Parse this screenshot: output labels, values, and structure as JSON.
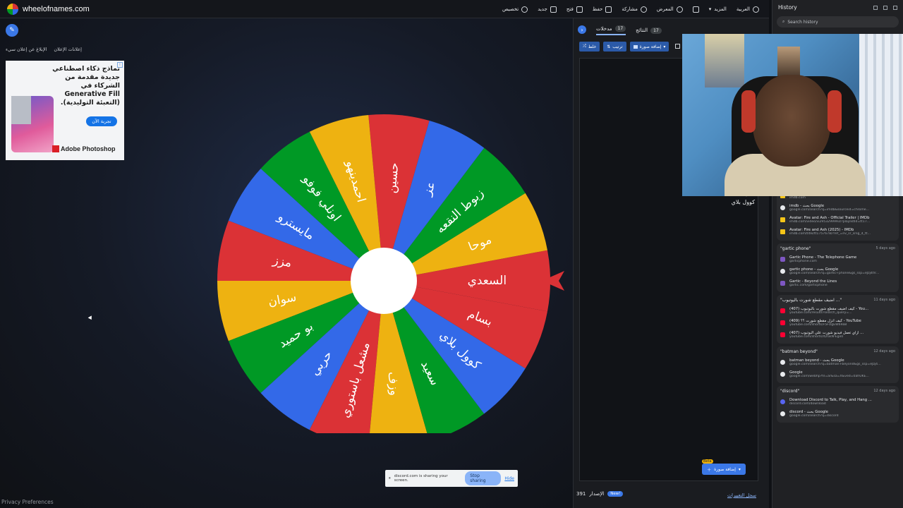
{
  "app": {
    "site_name": "wheelofnames.com",
    "privacy": "Privacy Preferences"
  },
  "nav": [
    {
      "label": "العربية",
      "icon": "globe-icon"
    },
    {
      "label": "المزيد",
      "icon": "chevron-down-icon"
    },
    {
      "label": "",
      "icon": "fullscreen-icon"
    },
    {
      "label": "المعرض",
      "icon": "search-icon"
    },
    {
      "label": "مشاركة",
      "icon": "share-icon"
    },
    {
      "label": "حفظ",
      "icon": "save-icon"
    },
    {
      "label": "فتح",
      "icon": "folder-icon"
    },
    {
      "label": "جديد",
      "icon": "file-icon"
    },
    {
      "label": "تخصيص",
      "icon": "palette-icon"
    }
  ],
  "report": {
    "report_ad": "الإبلاغ عن إعلان سيء",
    "about_ads": "إعلانات الإعلان"
  },
  "ad": {
    "headline": "نماذج ذكاء اصطناعي جديدة مقدمة من الشركاء في Generative Fill (التعبئة التوليدية).",
    "cta": "تجربة الآن",
    "brand": "Adobe Photoshop"
  },
  "wheel": {
    "colors": [
      "#db3236",
      "#3369e8",
      "#009925",
      "#eeb211"
    ],
    "pointer_color": "#db3236",
    "segments": [
      "السعدي",
      "موحا",
      "زبوط النقعه",
      "عز",
      "حسين",
      "احمدينهو",
      "اونلي فوفو",
      "مايسترو",
      "مزز",
      "سوان",
      "بو حميد",
      "حربي",
      "مشعل باستوري",
      "وزف",
      "سعيد",
      "كوول بلاي",
      "بسام"
    ]
  },
  "panel": {
    "tab_entries": "مدخلات",
    "tab_entries_count": "17",
    "tab_results": "النتائج",
    "tab_results_count": "17",
    "shuffle": "خلط",
    "sort": "ترتيب",
    "add_image": "إضافة صورة",
    "entries": [
      "بسام",
      "السعدي",
      "موحا",
      "زبوط النقعه",
      "عز",
      "حسين",
      "احمدينهو",
      "اونلي فوفو",
      "مايسترو",
      "مزز",
      "سوان",
      "بو حميد",
      "حربي",
      "مشعل باستوري",
      "وزف",
      "سعيد",
      "كوول بلاي"
    ],
    "beta": "Beta",
    "add_image_bottom": "إضافة صورة",
    "version_label": "الإصدار",
    "version": "391",
    "new_badge": "New!",
    "changelog": "سجل التغييرات"
  },
  "share_bar": {
    "text": "discord.com is sharing your screen.",
    "stop": "Stop sharing",
    "hide": "Hide"
  },
  "history": {
    "title": "History",
    "search_placeholder": "Search history",
    "groups": [
      {
        "title": "",
        "date": "",
        "items": [
          {
            "t": "IMDb: Ratings, Reviews, and Where to Wat...",
            "u": "imdb.com",
            "fav": "imdb"
          },
          {
            "t": "imdb - بحث Google",
            "u": "google.com/search?q=imdb&sourceid=chrome...",
            "fav": "google"
          },
          {
            "t": "Avatar: Fire and Ash - Official Trailer | IMDb",
            "u": "imdb.com/video/vi2953299993/?playlistId=tt17...",
            "fav": "imdb"
          },
          {
            "t": "Avatar: Fire and Ash (2025) - IMDb",
            "u": "imdb.com/title/tt1757678/?ref_=nv_sr_srsg_4_tt...",
            "fav": "imdb"
          }
        ]
      },
      {
        "title": "\"gartic phone\"",
        "date": "5 days ago",
        "items": [
          {
            "t": "Gartic Phone - The Telephone Game",
            "u": "garticphone.com",
            "fav": "gartic"
          },
          {
            "t": "gartic phone - بحث Google",
            "u": "google.com/search?q=gartic+phone&gs_ssp=eJzj4tVP1...",
            "fav": "google"
          },
          {
            "t": "Gartic - Beyond the Lines",
            "u": "gartic.com/garticphone",
            "fav": "gartic"
          }
        ]
      },
      {
        "title": "\"اضيف مقطع شورت باليوتيوب ...\"",
        "date": "11 days ago",
        "items": [
          {
            "t": "(407) كيف اضيف مقطع شورت باليوتيوب - You...",
            "u": "youtube.com/results?search_query=...",
            "fav": "yt"
          },
          {
            "t": "(409) كيف انزل مقطع شورت ؟؟ - YouTube",
            "u": "youtube.com/shorts/F5FOgEW69a8",
            "fav": "yt"
          },
          {
            "t": "(407) ازاي تعمل فيديو شورت علي اليوتيوب ...",
            "u": "youtube.com/shorts/lt2GkN-Egx0",
            "fav": "yt"
          }
        ]
      },
      {
        "title": "\"batman beyond\"",
        "date": "12 days ago",
        "items": [
          {
            "t": "batman beyond - بحث Google",
            "u": "google.com/search?q=batman+beyond&gs_ssp=eJzj4tTP1...",
            "fav": "google"
          },
          {
            "t": "Google",
            "u": "google.com/webhp?hl=ar&sa=X&ved=0ahUKE...",
            "fav": "google"
          }
        ]
      },
      {
        "title": "\"discord\"",
        "date": "12 days ago",
        "items": [
          {
            "t": "Download Discord to Talk, Play, and Hang ...",
            "u": "discord.com/download",
            "fav": "discord"
          },
          {
            "t": "discord - بحث Google",
            "u": "google.com/search?q=discord",
            "fav": "google"
          }
        ]
      }
    ]
  }
}
